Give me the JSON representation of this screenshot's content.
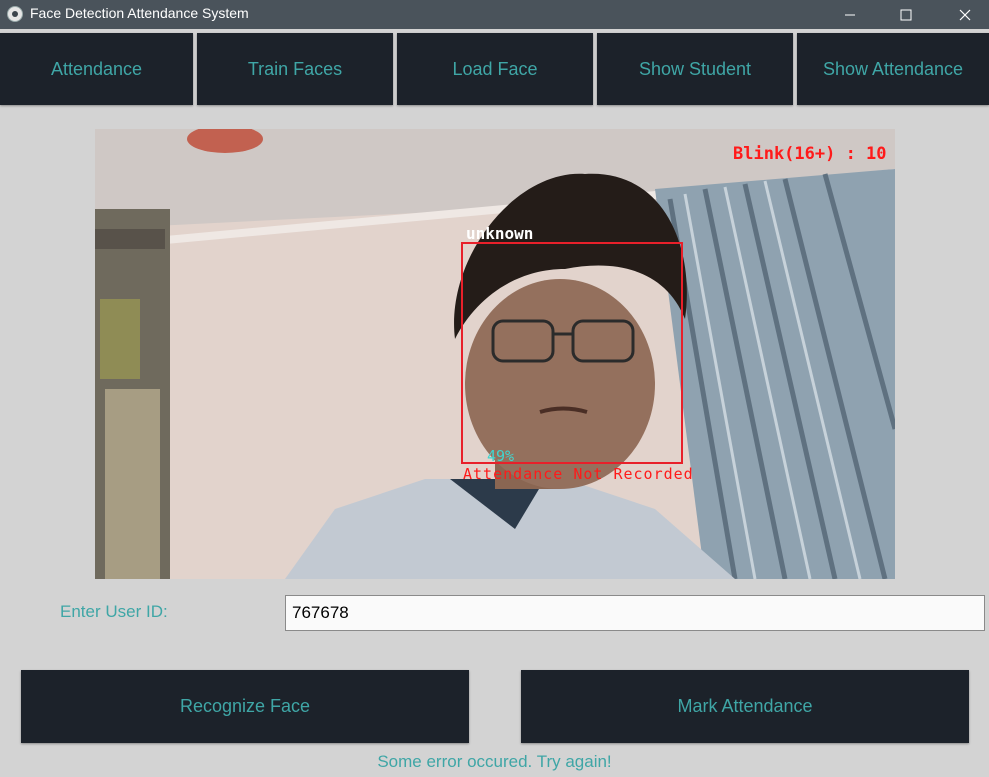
{
  "window": {
    "title": "Face Detection Attendance System",
    "controls": [
      "minimize-icon",
      "maximize-icon",
      "close-icon"
    ]
  },
  "nav": {
    "tabs": [
      {
        "label": "Attendance"
      },
      {
        "label": "Train Faces"
      },
      {
        "label": "Load Face"
      },
      {
        "label": "Show Student"
      },
      {
        "label": "Show Attendance"
      }
    ]
  },
  "camera": {
    "blink_text": "Blink(16+) : 10",
    "face_name": "unknown",
    "confidence": "49%",
    "attendance_status": "Attendance Not Recorded"
  },
  "form": {
    "user_id_label": "Enter User ID:",
    "user_id_value": "767678"
  },
  "actions": {
    "recognize_label": "Recognize Face",
    "mark_label": "Mark Attendance"
  },
  "status": {
    "message": "Some error occured. Try again!"
  },
  "colors": {
    "titlebar": "#4a535b",
    "button_bg": "#1c222a",
    "accent_text": "#3fa6a6",
    "background": "#d3d3d3",
    "face_box": "#e8202a",
    "overlay_red": "#ff1a1a",
    "overlay_cyan": "#3fd6d0"
  }
}
